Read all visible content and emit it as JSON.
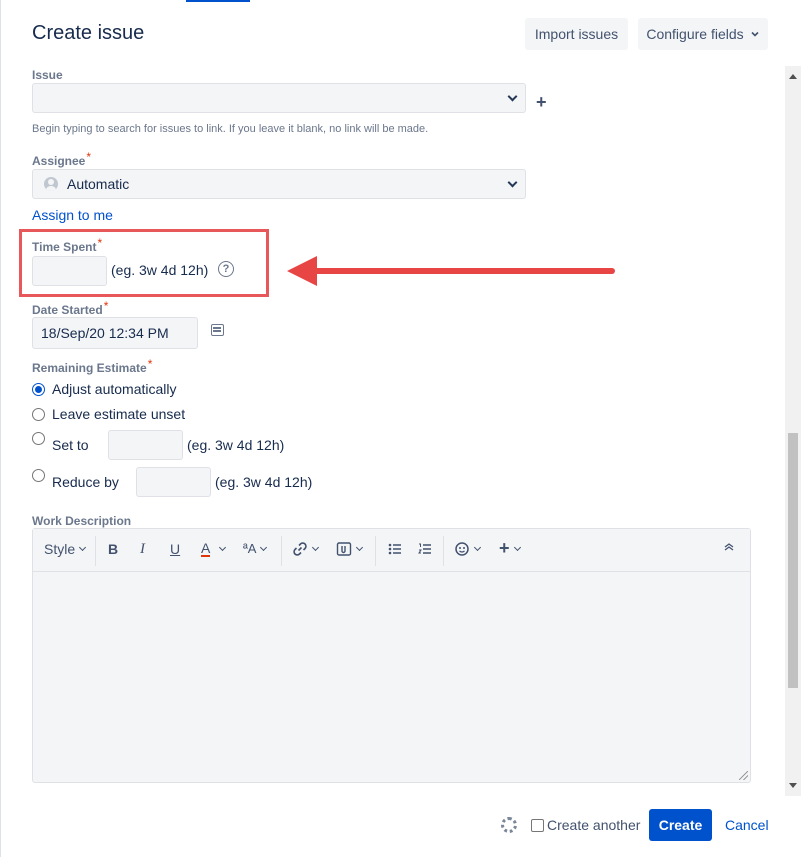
{
  "dialog": {
    "title": "Create issue",
    "import_label": "Import issues",
    "configure_label": "Configure fields"
  },
  "issue": {
    "label": "Issue",
    "value": "",
    "help": "Begin typing to search for issues to link. If you leave it blank, no link will be made."
  },
  "assignee": {
    "label": "Assignee",
    "value": "Automatic",
    "assign_link": "Assign to me"
  },
  "time_spent": {
    "label": "Time Spent",
    "value": "",
    "hint": "(eg. 3w 4d 12h)",
    "help_icon": "?"
  },
  "date_started": {
    "label": "Date Started",
    "value": "18/Sep/20 12:34 PM"
  },
  "remaining_estimate": {
    "label": "Remaining Estimate",
    "options": [
      {
        "label": "Adjust automatically",
        "checked": true
      },
      {
        "label": "Leave estimate unset",
        "checked": false
      },
      {
        "label": "Set to",
        "checked": false,
        "hint": "(eg. 3w 4d 12h)"
      },
      {
        "label": "Reduce by",
        "checked": false,
        "hint": "(eg. 3w 4d 12h)"
      }
    ]
  },
  "work_description": {
    "label": "Work Description",
    "toolbar": {
      "style": "Style",
      "bold": "B",
      "italic": "I",
      "underline": "U",
      "text_color": "A",
      "more_formatting": "ªA",
      "add": "+"
    }
  },
  "footer": {
    "create_another": "Create another",
    "create": "Create",
    "cancel": "Cancel"
  },
  "colors": {
    "primary": "#0052cc",
    "annotation": "#e84545",
    "required": "#de350b"
  }
}
